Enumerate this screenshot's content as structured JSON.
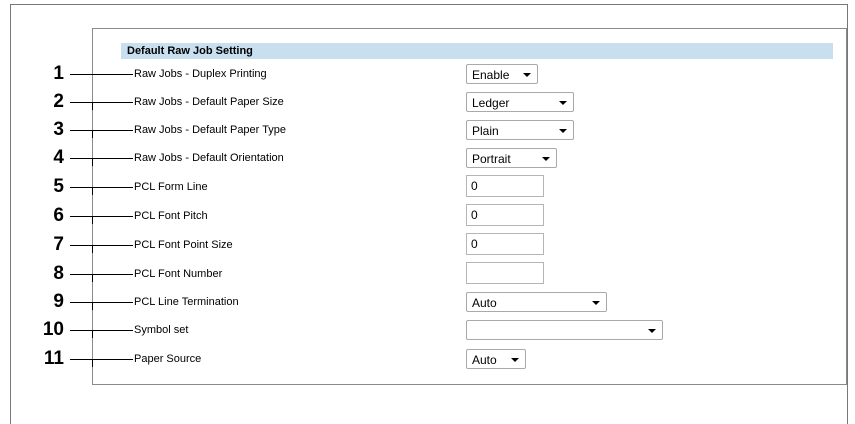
{
  "section": {
    "title": "Default Raw Job Setting"
  },
  "rows": [
    {
      "callout": "1",
      "label": "Raw Jobs - Duplex Printing",
      "type": "select",
      "value": "Enable"
    },
    {
      "callout": "2",
      "label": "Raw Jobs - Default Paper Size",
      "type": "select",
      "value": "Ledger"
    },
    {
      "callout": "3",
      "label": "Raw Jobs - Default Paper Type",
      "type": "select",
      "value": "Plain"
    },
    {
      "callout": "4",
      "label": "Raw Jobs - Default Orientation",
      "type": "select",
      "value": "Portrait"
    },
    {
      "callout": "5",
      "label": "PCL Form Line",
      "type": "input",
      "value": "0"
    },
    {
      "callout": "6",
      "label": "PCL Font Pitch",
      "type": "input",
      "value": "0"
    },
    {
      "callout": "7",
      "label": "PCL Font Point Size",
      "type": "input",
      "value": "0"
    },
    {
      "callout": "8",
      "label": "PCL Font Number",
      "type": "input",
      "value": ""
    },
    {
      "callout": "9",
      "label": "PCL Line Termination",
      "type": "select",
      "value": "Auto"
    },
    {
      "callout": "10",
      "label": "Symbol set",
      "type": "select",
      "value": ""
    },
    {
      "callout": "11",
      "label": "Paper Source",
      "type": "select",
      "value": "Auto"
    }
  ],
  "icons": {
    "dropdown": "chevron-down-icon"
  },
  "colors": {
    "section_header_bg": "#c8dff0",
    "panel_border": "#8a8a8a"
  }
}
